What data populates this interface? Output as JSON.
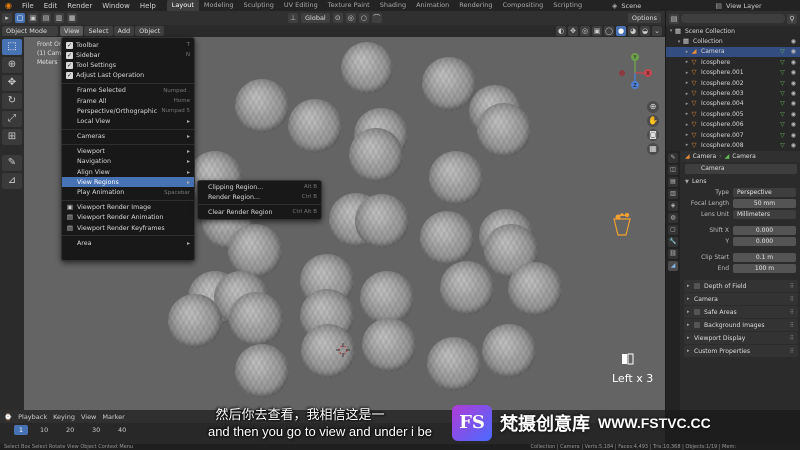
{
  "topbar": {
    "menus": [
      "File",
      "Edit",
      "Render",
      "Window",
      "Help"
    ],
    "workspaces": [
      "Layout",
      "Modeling",
      "Sculpting",
      "UV Editing",
      "Texture Paint",
      "Shading",
      "Animation",
      "Rendering",
      "Compositing",
      "Scripting"
    ],
    "active_workspace": "Layout",
    "scene": "Scene",
    "view_layer": "View Layer"
  },
  "viewport_header": {
    "mode": "Object Mode",
    "menus": [
      "View",
      "Select",
      "Add",
      "Object"
    ],
    "orientation": "Global",
    "options": "Options"
  },
  "viewport": {
    "info_lines": [
      "Front Or",
      "(1) Cam",
      "Meters"
    ],
    "gizmo_labels": {
      "y": "Y",
      "x": "X",
      "z": "Z"
    },
    "key_hint": "Left x 3"
  },
  "view_menu": {
    "items": [
      {
        "type": "check",
        "label": "Toolbar",
        "shortcut": "T",
        "checked": true
      },
      {
        "type": "check",
        "label": "Sidebar",
        "shortcut": "N",
        "checked": true
      },
      {
        "type": "check",
        "label": "Tool Settings",
        "shortcut": "",
        "checked": true
      },
      {
        "type": "check",
        "label": "Adjust Last Operation",
        "shortcut": "",
        "checked": true
      },
      {
        "type": "sep"
      },
      {
        "type": "item",
        "label": "Frame Selected",
        "shortcut": "Numpad ."
      },
      {
        "type": "item",
        "label": "Frame All",
        "shortcut": "Home"
      },
      {
        "type": "item",
        "label": "Perspective/Orthographic",
        "shortcut": "Numpad 5"
      },
      {
        "type": "sub",
        "label": "Local View"
      },
      {
        "type": "sep"
      },
      {
        "type": "sub",
        "label": "Cameras"
      },
      {
        "type": "sep"
      },
      {
        "type": "sub",
        "label": "Viewport"
      },
      {
        "type": "sub",
        "label": "Navigation"
      },
      {
        "type": "sub",
        "label": "Align View"
      },
      {
        "type": "sub",
        "label": "View Regions",
        "highlight": true
      },
      {
        "type": "item",
        "label": "Play Animation",
        "shortcut": "Spacebar"
      },
      {
        "type": "sep"
      },
      {
        "type": "icon",
        "label": "Viewport Render Image",
        "icon": "▣"
      },
      {
        "type": "icon",
        "label": "Viewport Render Animation",
        "icon": "▤"
      },
      {
        "type": "icon",
        "label": "Viewport Render Keyframes",
        "icon": "▤"
      },
      {
        "type": "sep"
      },
      {
        "type": "sub",
        "label": "Area"
      }
    ]
  },
  "submenu": {
    "items": [
      {
        "label": "Clipping Region...",
        "shortcut": "Alt B"
      },
      {
        "label": "Render Region...",
        "shortcut": "Ctrl B"
      },
      {
        "label": "Clear Render Region",
        "shortcut": "Ctrl Alt B"
      }
    ]
  },
  "outliner": {
    "rows": [
      {
        "label": "Scene Collection",
        "icon": "▦",
        "indent": 0,
        "icon_color": "#d0d0d0"
      },
      {
        "label": "Collection",
        "icon": "▦",
        "indent": 1,
        "icon_color": "#d0d0d0"
      },
      {
        "label": "Camera",
        "icon": "◢",
        "indent": 2,
        "icon_color": "#e98c36",
        "selected": true
      },
      {
        "label": "Icosphere",
        "icon": "▽",
        "indent": 2,
        "icon_color": "#e98c36"
      },
      {
        "label": "Icosphere.001",
        "icon": "▽",
        "indent": 2,
        "icon_color": "#e98c36"
      },
      {
        "label": "Icosphere.002",
        "icon": "▽",
        "indent": 2,
        "icon_color": "#e98c36"
      },
      {
        "label": "Icosphere.003",
        "icon": "▽",
        "indent": 2,
        "icon_color": "#e98c36"
      },
      {
        "label": "Icosphere.004",
        "icon": "▽",
        "indent": 2,
        "icon_color": "#e98c36"
      },
      {
        "label": "Icosphere.005",
        "icon": "▽",
        "indent": 2,
        "icon_color": "#e98c36"
      },
      {
        "label": "Icosphere.006",
        "icon": "▽",
        "indent": 2,
        "icon_color": "#e98c36"
      },
      {
        "label": "Icosphere.007",
        "icon": "▽",
        "indent": 2,
        "icon_color": "#e98c36"
      },
      {
        "label": "Icosphere.008",
        "icon": "▽",
        "indent": 2,
        "icon_color": "#e98c36"
      }
    ]
  },
  "properties": {
    "object_name": "Camera",
    "data_name": "Camera",
    "data_field": "Camera",
    "lens_panel": "Lens",
    "lens_rows": [
      {
        "label": "Type",
        "value": "Perspective"
      },
      {
        "label": "Focal Length",
        "value": "50 mm"
      },
      {
        "label": "Lens Unit",
        "value": "Millimeters"
      },
      {
        "label": "Shift X",
        "value": "0.000"
      },
      {
        "label": "Y",
        "value": "0.000"
      },
      {
        "label": "Clip Start",
        "value": "0.1 m"
      },
      {
        "label": "End",
        "value": "100 m"
      }
    ],
    "panels": [
      "Depth of Field",
      "Camera",
      "Safe Areas",
      "Background Images",
      "Viewport Display",
      "Custom Properties"
    ]
  },
  "timeline": {
    "menus": [
      "Playback",
      "Keying",
      "View",
      "Marker"
    ],
    "current_frame": "1",
    "frame_labels": [
      "10",
      "20",
      "30",
      "40"
    ]
  },
  "statusbar": {
    "left": "Select      Box Select            Rotate View                         Object Context Menu",
    "right": "Collection | Camera | Verts:5,184 | Faces:4,493 | Tris:10,368 | Objects:1/19 | Mem:"
  },
  "overlays": {
    "subtitle_cn": "然后你去查看，我相信这是一",
    "subtitle_en": "and then you go to view and under i be",
    "watermark_logo": "FS",
    "watermark_text": "梵摄创意库",
    "watermark_url": "WWW.FSTVC.CC"
  },
  "colors": {
    "accent": "#4772b3",
    "object_orange": "#e98c36",
    "viewport_bg": "#646464"
  }
}
